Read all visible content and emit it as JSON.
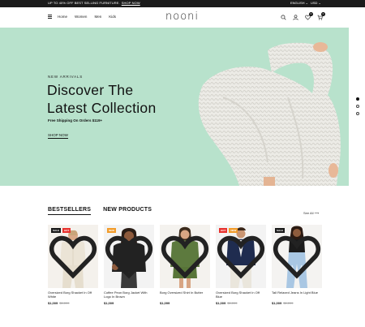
{
  "topbar": {
    "promo": "UP TO 40% OFF BEST SELLING FURNITURE.",
    "shop_link": "SHOP NOW",
    "language": "ENGLISH ⌄",
    "currency": "USD ⌄"
  },
  "header": {
    "logo": "nooni",
    "nav": [
      "Home",
      "Women",
      "Men",
      "Kids"
    ],
    "wishlist_count": "0",
    "cart_count": "0"
  },
  "hero": {
    "eyebrow": "NEW ARRIVALS",
    "title_line1": "Discover The",
    "title_line2": "Latest Collection",
    "shipping": "Free Shipping On Orders $119+",
    "cta": "SHOP NOW",
    "background_color": "#b8e2cc",
    "slides": 3,
    "active_slide": 1
  },
  "products_section": {
    "tabs": [
      "BESTSELLERS",
      "NEW PRODUCTS"
    ],
    "active_tab": 0,
    "see_all": "See All ⟶",
    "products": [
      {
        "name": "Oversized Borg Shacket In Off White",
        "price": "$1,009",
        "old_price": "$1,099",
        "badges": [
          {
            "text": "SALE",
            "type": "sale"
          },
          {
            "text": "HOT",
            "type": "hot"
          }
        ]
      },
      {
        "name": "Coffee Peon Borg Jacket With Logo In Brown",
        "price": "$1,009",
        "old_price": "",
        "badges": [
          {
            "text": "NEW",
            "type": "new"
          }
        ]
      },
      {
        "name": "Borg Oversized Shirt In Butter",
        "price": "$1,099",
        "old_price": "",
        "badges": []
      },
      {
        "name": "Oversized Borg Shacket In Off Blue",
        "price": "$1,009",
        "old_price": "$1,099",
        "badges": [
          {
            "text": "HOT",
            "type": "hot"
          },
          {
            "text": "NEW",
            "type": "new"
          }
        ]
      },
      {
        "name": "Tall Relaxed Jeans In Light Blue",
        "price": "$1,009",
        "old_price": "$1,099",
        "badges": [
          {
            "text": "SALE",
            "type": "sale"
          }
        ]
      }
    ]
  }
}
